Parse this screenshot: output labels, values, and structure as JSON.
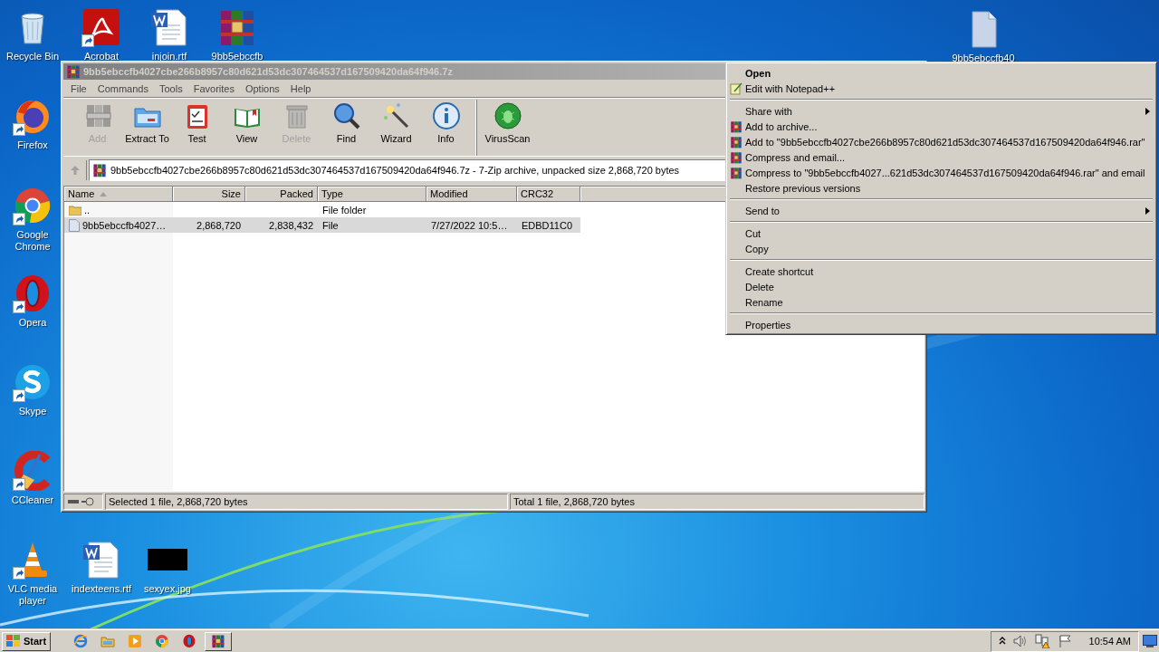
{
  "desktop_icons": [
    {
      "label": "Recycle Bin",
      "kind": "recycle",
      "shortcut": false
    },
    {
      "label": "Acrobat",
      "kind": "pdf",
      "shortcut": true
    },
    {
      "label": "injoin.rtf",
      "kind": "word",
      "shortcut": false
    },
    {
      "label": "9bb5ebccfb",
      "kind": "rar",
      "shortcut": false
    },
    {
      "label": "Firefox",
      "kind": "firefox",
      "shortcut": true
    },
    {
      "label": "Google Chrome",
      "kind": "chrome",
      "shortcut": true
    },
    {
      "label": "Opera",
      "kind": "opera",
      "shortcut": true
    },
    {
      "label": "Skype",
      "kind": "skype",
      "shortcut": true
    },
    {
      "label": "CCleaner",
      "kind": "ccleaner",
      "shortcut": true
    },
    {
      "label": "VLC media player",
      "kind": "vlc",
      "shortcut": true
    },
    {
      "label": "indexteens.rtf",
      "kind": "word",
      "shortcut": false
    },
    {
      "label": "sexyex.jpg",
      "kind": "image",
      "shortcut": false
    },
    {
      "label": "9bb5ebccfb40",
      "kind": "file",
      "shortcut": false
    }
  ],
  "window": {
    "title": "9bb5ebccfb4027cbe266b8957c80d621d53dc307464537d167509420da64f946.7z",
    "active": false,
    "menu": [
      "File",
      "Commands",
      "Tools",
      "Favorites",
      "Options",
      "Help"
    ],
    "toolbar": [
      [
        {
          "label": "Add",
          "kind": "add",
          "disabled": true
        },
        {
          "label": "Extract To",
          "kind": "extract",
          "disabled": false
        },
        {
          "label": "Test",
          "kind": "test",
          "disabled": false
        },
        {
          "label": "View",
          "kind": "view",
          "disabled": false
        },
        {
          "label": "Delete",
          "kind": "delete",
          "disabled": true
        },
        {
          "label": "Find",
          "kind": "find",
          "disabled": false
        },
        {
          "label": "Wizard",
          "kind": "wizard",
          "disabled": false
        },
        {
          "label": "Info",
          "kind": "info",
          "disabled": false
        }
      ],
      [
        {
          "label": "VirusScan",
          "kind": "virus",
          "disabled": false
        }
      ]
    ],
    "address": "9bb5ebccfb4027cbe266b8957c80d621d53dc307464537d167509420da64f946.7z - 7-Zip archive, unpacked size 2,868,720 bytes",
    "columns": [
      {
        "label": "Name",
        "sorted": true
      },
      {
        "label": "Size",
        "sorted": false
      },
      {
        "label": "Packed",
        "sorted": false
      },
      {
        "label": "Type",
        "sorted": false
      },
      {
        "label": "Modified",
        "sorted": false
      },
      {
        "label": "CRC32",
        "sorted": false
      }
    ],
    "rows": [
      {
        "kind": "folder",
        "selected": false,
        "cells": [
          "..",
          "",
          "",
          "File folder",
          "",
          ""
        ]
      },
      {
        "kind": "file",
        "selected": true,
        "cells": [
          "9bb5ebccfb4027…",
          "2,868,720",
          "2,838,432",
          "File",
          "7/27/2022 10:5…",
          "EDBD11C0"
        ]
      }
    ],
    "status": [
      "Selected 1 file, 2,868,720 bytes",
      "Total 1 file, 2,868,720 bytes"
    ]
  },
  "context_menu": {
    "groups": [
      [
        {
          "label": "Open",
          "bold": true,
          "kind": "plain",
          "submenu": false
        },
        {
          "label": "Edit with Notepad++",
          "bold": false,
          "kind": "notepad",
          "submenu": false
        }
      ],
      [
        {
          "label": "Share with",
          "bold": false,
          "kind": "plain",
          "submenu": true
        },
        {
          "label": "Add to archive...",
          "bold": false,
          "kind": "rar",
          "submenu": false
        },
        {
          "label": "Add to \"9bb5ebccfb4027cbe266b8957c80d621d53dc307464537d167509420da64f946.rar\"",
          "bold": false,
          "kind": "rar",
          "submenu": false
        },
        {
          "label": "Compress and email...",
          "bold": false,
          "kind": "rar",
          "submenu": false
        },
        {
          "label": "Compress to \"9bb5ebccfb4027...621d53dc307464537d167509420da64f946.rar\" and email",
          "bold": false,
          "kind": "rar",
          "submenu": false
        },
        {
          "label": "Restore previous versions",
          "bold": false,
          "kind": "plain",
          "submenu": false
        }
      ],
      [
        {
          "label": "Send to",
          "bold": false,
          "kind": "plain",
          "submenu": true
        }
      ],
      [
        {
          "label": "Cut",
          "bold": false,
          "kind": "plain",
          "submenu": false
        },
        {
          "label": "Copy",
          "bold": false,
          "kind": "plain",
          "submenu": false
        }
      ],
      [
        {
          "label": "Create shortcut",
          "bold": false,
          "kind": "plain",
          "submenu": false
        },
        {
          "label": "Delete",
          "bold": false,
          "kind": "plain",
          "submenu": false
        },
        {
          "label": "Rename",
          "bold": false,
          "kind": "plain",
          "submenu": false
        }
      ],
      [
        {
          "label": "Properties",
          "bold": false,
          "kind": "plain",
          "submenu": false
        }
      ]
    ]
  },
  "taskbar": {
    "start": "Start",
    "apps": [
      {
        "kind": "ie",
        "open": false
      },
      {
        "kind": "explorer",
        "open": false
      },
      {
        "kind": "media",
        "open": false
      },
      {
        "kind": "chrome",
        "open": false
      },
      {
        "kind": "opera",
        "open": false
      },
      {
        "kind": "rar",
        "open": true
      }
    ],
    "clock": "10:54 AM"
  }
}
